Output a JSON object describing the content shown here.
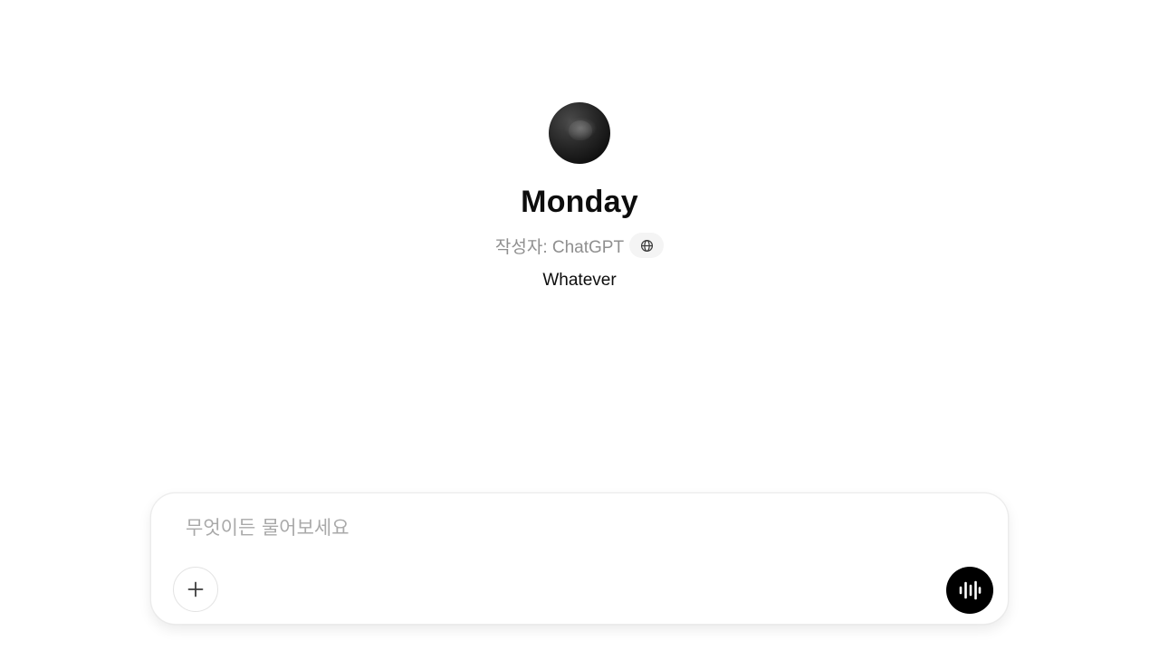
{
  "gpt": {
    "name": "Monday",
    "author": "작성자: ChatGPT",
    "description": "Whatever",
    "avatar_icon": "dark-cat-avatar",
    "visibility_icon": "globe-icon"
  },
  "composer": {
    "placeholder": "무엇이든 물어보세요",
    "value": "",
    "attach_icon": "plus-icon",
    "voice_icon": "voice-waveform-icon"
  },
  "colors": {
    "background": "#ffffff",
    "text_primary": "#0d0d0d",
    "text_muted": "#8f8f8f",
    "voice_button": "#000000"
  }
}
